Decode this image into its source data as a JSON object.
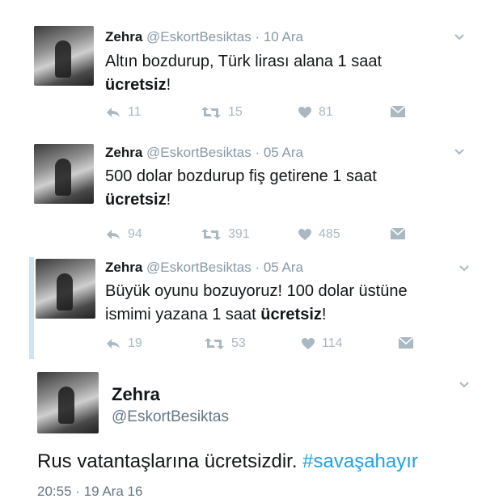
{
  "tweets": [
    {
      "name": "Zehra",
      "handle": "@EskortBesiktas",
      "date": "· 10 Ara",
      "line1": "Altın bozdurup, Türk lirası alana 1 saat",
      "line2_pre": "",
      "line2_bold": "ücretsiz",
      "line2_post": "!",
      "replies": "11",
      "retweets": "15",
      "likes": "81"
    },
    {
      "name": "Zehra",
      "handle": "@EskortBesiktas",
      "date": "· 05 Ara",
      "line1": "500 dolar bozdurup fiş getirene 1 saat",
      "line2_pre": "",
      "line2_bold": "ücretsiz",
      "line2_post": "!",
      "replies": "94",
      "retweets": "391",
      "likes": "485"
    },
    {
      "name": "Zehra",
      "handle": "@EskortBesiktas",
      "date": "· 05 Ara",
      "line1": "Büyük oyunu bozuyoruz! 100 dolar üstüne",
      "line2_pre": "ismimi yazana 1 saat ",
      "line2_bold": "ücretsiz",
      "line2_post": "!",
      "replies": "19",
      "retweets": "53",
      "likes": "114"
    }
  ],
  "main_tweet": {
    "name": "Zehra",
    "handle": "@EskortBesiktas",
    "text": "Rus vatantaşlarına ücretsizdir. ",
    "hashtag": "#savaşahayır",
    "timestamp": "20:55 · 19 Ara 16"
  },
  "colors": {
    "hashtag": "#1da1f2",
    "muted": "#8899a6",
    "action": "#aab8c2"
  }
}
